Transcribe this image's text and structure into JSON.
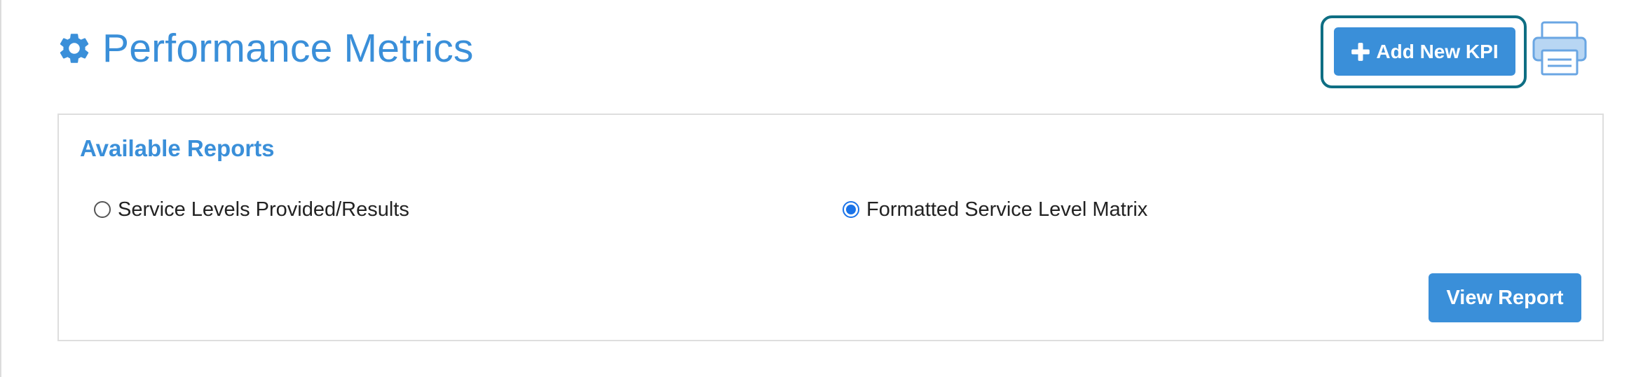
{
  "header": {
    "title": "Performance Metrics",
    "icon": "gear-icon"
  },
  "toolbar": {
    "add_kpi_label": "Add New KPI",
    "add_kpi_icon": "plus-icon",
    "print_icon": "printer-icon"
  },
  "reports": {
    "title": "Available Reports",
    "options": [
      {
        "label": "Service Levels Provided/Results",
        "checked": false
      },
      {
        "label": "Formatted Service Level Matrix",
        "checked": true
      }
    ],
    "view_label": "View Report"
  },
  "colors": {
    "accent": "#3a8fd9",
    "focus_ring": "#0e6e83",
    "radio_checked": "#1a73e8",
    "panel_border": "#dedede",
    "text": "#222222"
  }
}
